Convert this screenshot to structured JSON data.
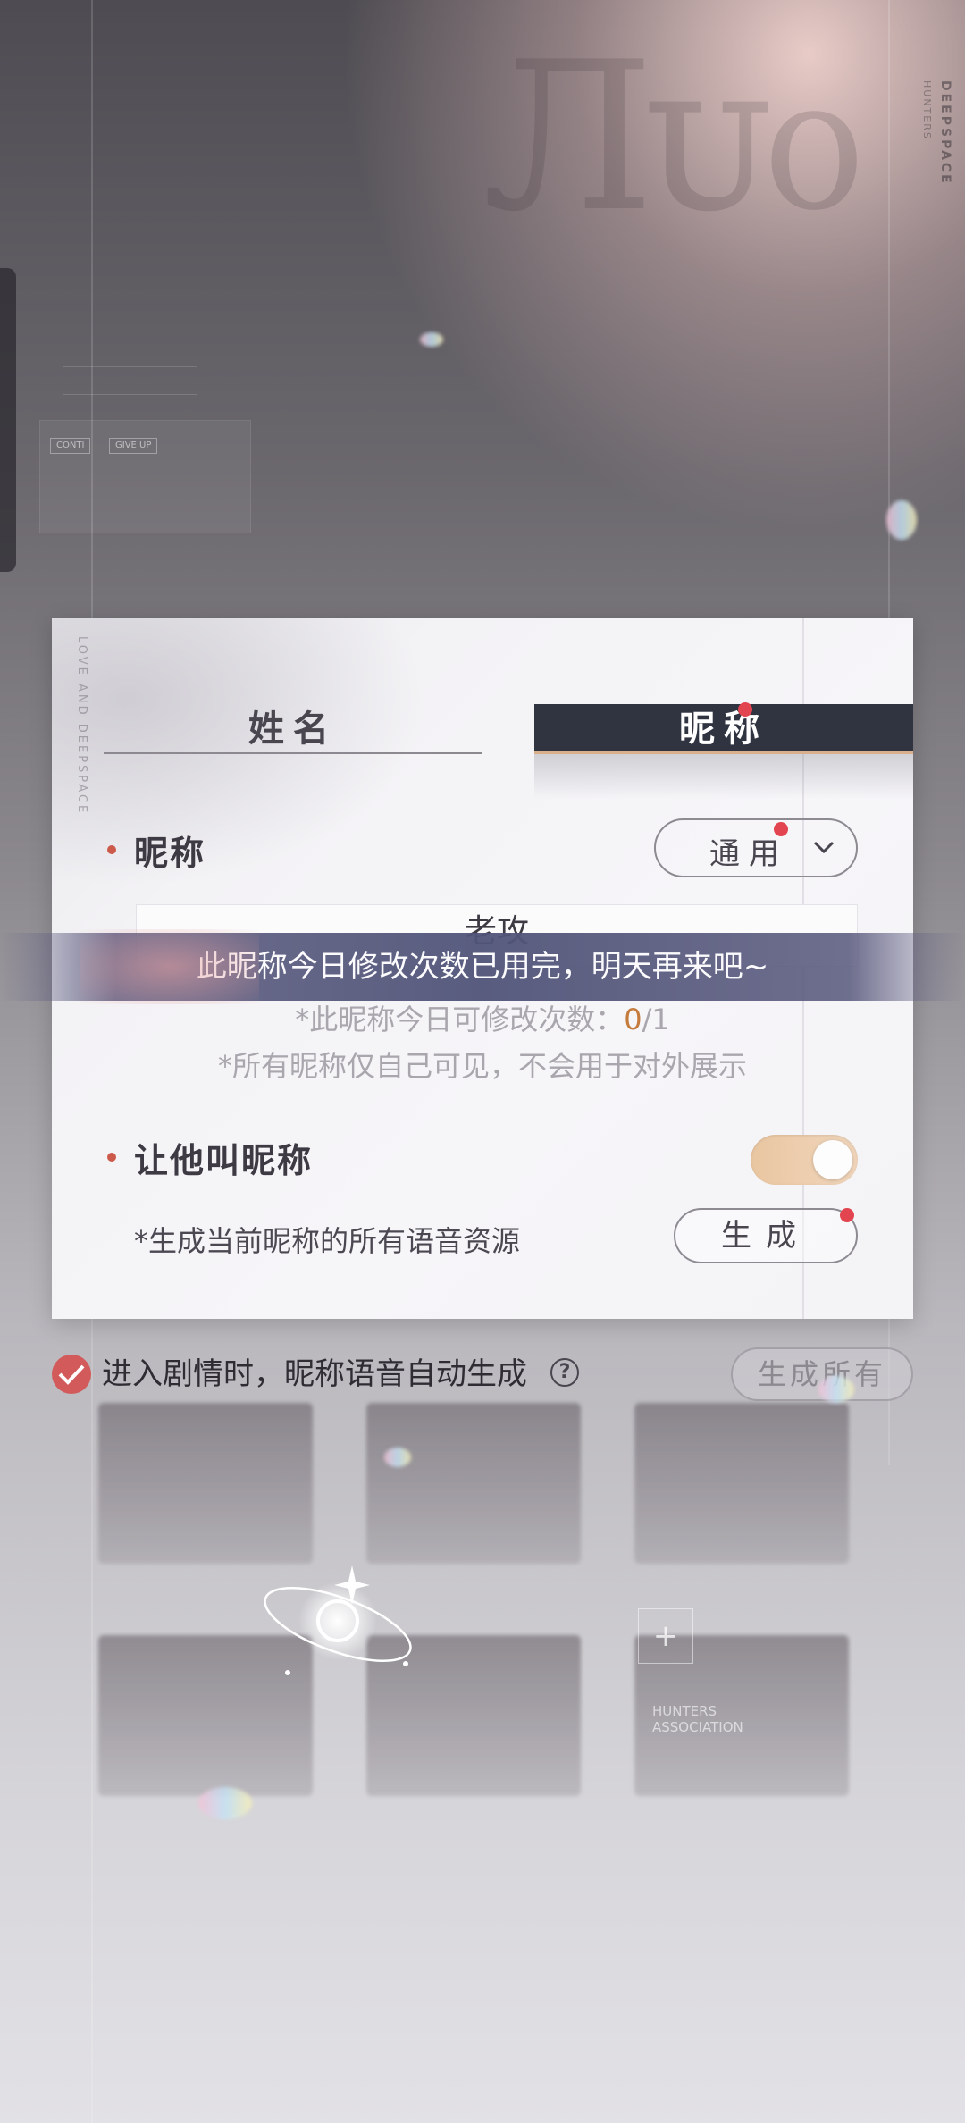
{
  "background": {
    "brand_vertical": "DEEPSPACE",
    "brand_vertical_sub": "HUNTERS",
    "ghost_buttons": [
      "CONTI",
      "GIVE UP"
    ],
    "hunters_association": "HUNTERS ASSOCIATION"
  },
  "dialog": {
    "side_text": "LOVE AND DEEPSPACE",
    "tabs": [
      {
        "label": "姓名",
        "active": false
      },
      {
        "label": "昵称",
        "active": true
      }
    ],
    "nickname_section": {
      "label": "昵称",
      "dropdown_value": "通用",
      "input_value": "老攻",
      "hint_prefix": "*此昵称今日可修改次数：",
      "hint_count": "0",
      "hint_suffix": "/1",
      "hint_visibility": "*所有昵称仅自己可见，不会用于对外展示"
    },
    "call_section": {
      "label": "让他叫昵称",
      "toggle_on": true,
      "generate_desc": "*生成当前昵称的所有语音资源",
      "generate_button": "生成"
    }
  },
  "toast": {
    "message": "此昵称今日修改次数已用完，明天再来吧~"
  },
  "footer": {
    "auto_generate_checked": true,
    "auto_generate_label": "进入剧情时，昵称语音自动生成",
    "help_icon": "?",
    "generate_all_button": "生成所有"
  },
  "colors": {
    "accent_dark": "#2f3440",
    "accent_red": "#e2454f",
    "toggle_on": "#e9c6a1",
    "count_orange": "#c47b3c"
  }
}
